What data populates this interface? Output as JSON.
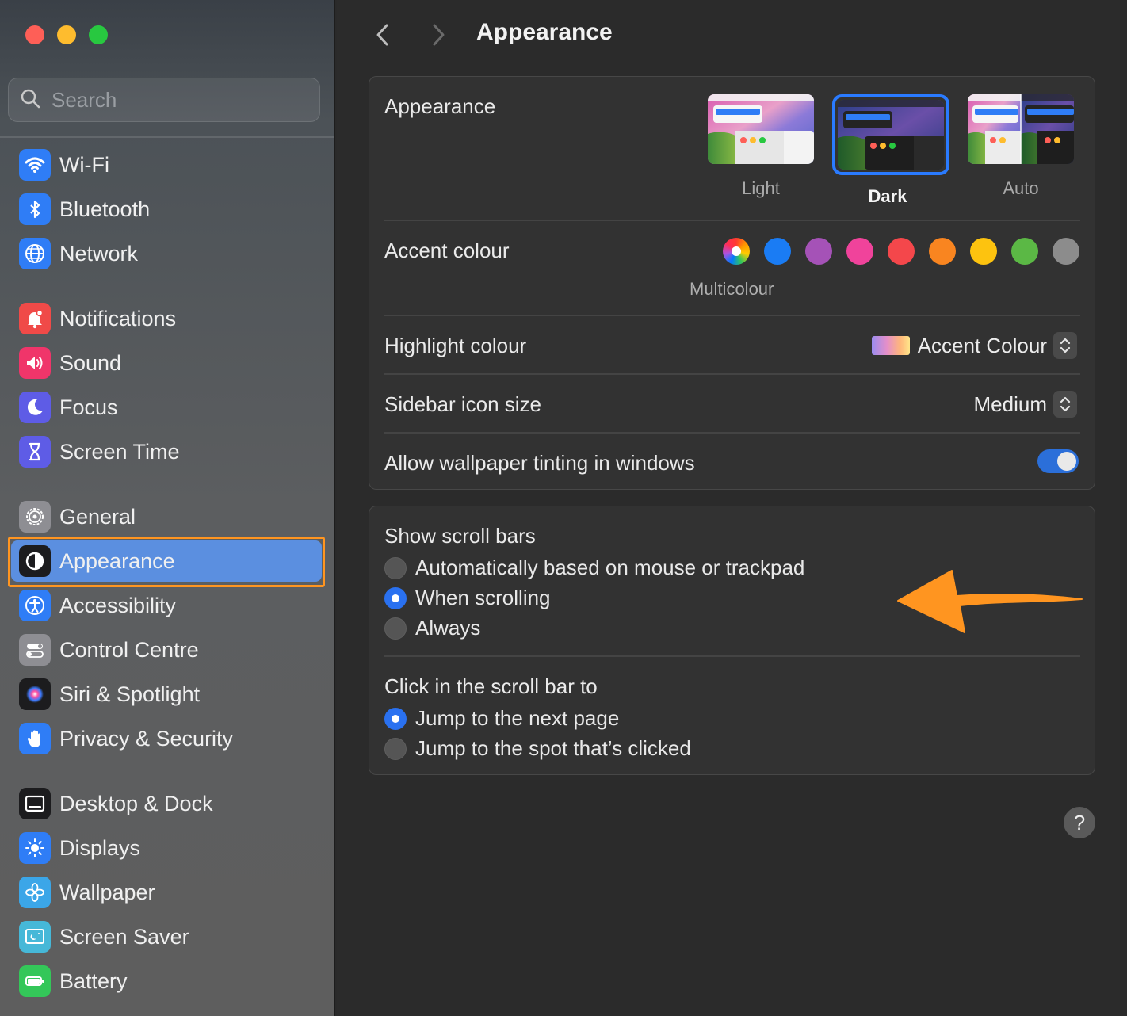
{
  "window": {
    "traffic_lights": [
      "close",
      "minimize",
      "zoom"
    ]
  },
  "search": {
    "placeholder": "Search"
  },
  "sidebar": {
    "items": [
      {
        "label": "Wi-Fi",
        "icon": "wifi-icon",
        "color": "#2f7df6"
      },
      {
        "label": "Bluetooth",
        "icon": "bluetooth-icon",
        "color": "#2f7df6"
      },
      {
        "label": "Network",
        "icon": "globe-icon",
        "color": "#2f7df6"
      },
      {
        "label": "Notifications",
        "icon": "bell-icon",
        "color": "#f04a48"
      },
      {
        "label": "Sound",
        "icon": "speaker-icon",
        "color": "#f0356a"
      },
      {
        "label": "Focus",
        "icon": "moon-icon",
        "color": "#5e5ce6"
      },
      {
        "label": "Screen Time",
        "icon": "hourglass-icon",
        "color": "#5e5ce6"
      },
      {
        "label": "General",
        "icon": "gear-icon",
        "color": "#8e8e93"
      },
      {
        "label": "Appearance",
        "icon": "appearance-icon",
        "color": "#1c1c1e",
        "selected": true
      },
      {
        "label": "Accessibility",
        "icon": "accessibility-icon",
        "color": "#2f7df6"
      },
      {
        "label": "Control Centre",
        "icon": "toggles-icon",
        "color": "#8e8e93"
      },
      {
        "label": "Siri & Spotlight",
        "icon": "siri-icon",
        "color": "#1c1c1e"
      },
      {
        "label": "Privacy & Security",
        "icon": "hand-icon",
        "color": "#2f7df6"
      },
      {
        "label": "Desktop & Dock",
        "icon": "dock-icon",
        "color": "#1c1c1e"
      },
      {
        "label": "Displays",
        "icon": "sun-icon",
        "color": "#2f7df6"
      },
      {
        "label": "Wallpaper",
        "icon": "flower-icon",
        "color": "#3ba6e8"
      },
      {
        "label": "Screen Saver",
        "icon": "screensaver-icon",
        "color": "#46b8d8"
      },
      {
        "label": "Battery",
        "icon": "battery-icon",
        "color": "#34c759"
      }
    ]
  },
  "header": {
    "title": "Appearance"
  },
  "appearance": {
    "label": "Appearance",
    "themes": [
      {
        "label": "Light",
        "selected": false
      },
      {
        "label": "Dark",
        "selected": true
      },
      {
        "label": "Auto",
        "selected": false
      }
    ],
    "accent_label": "Accent colour",
    "accent_colors": [
      "multicolour",
      "#1a7cf4",
      "#a552b7",
      "#f0439b",
      "#f4474b",
      "#f98520",
      "#fdc30f",
      "#5bb845",
      "#8c8c8c"
    ],
    "accent_caption": "Multicolour",
    "highlight_label": "Highlight colour",
    "highlight_value": "Accent Colour",
    "sidebar_icon_label": "Sidebar icon size",
    "sidebar_icon_value": "Medium",
    "tinting_label": "Allow wallpaper tinting in windows",
    "tinting_on": true
  },
  "scrollbars": {
    "show_label": "Show scroll bars",
    "show_options": [
      {
        "label": "Automatically based on mouse or trackpad",
        "selected": false
      },
      {
        "label": "When scrolling",
        "selected": true
      },
      {
        "label": "Always",
        "selected": false
      }
    ],
    "click_label": "Click in the scroll bar to",
    "click_options": [
      {
        "label": "Jump to the next page",
        "selected": true
      },
      {
        "label": "Jump to the spot that’s clicked",
        "selected": false
      }
    ]
  },
  "help": {
    "label": "?"
  },
  "annotation": {
    "arrow_color": "#ff9520",
    "highlight_color": "#ff9520"
  }
}
